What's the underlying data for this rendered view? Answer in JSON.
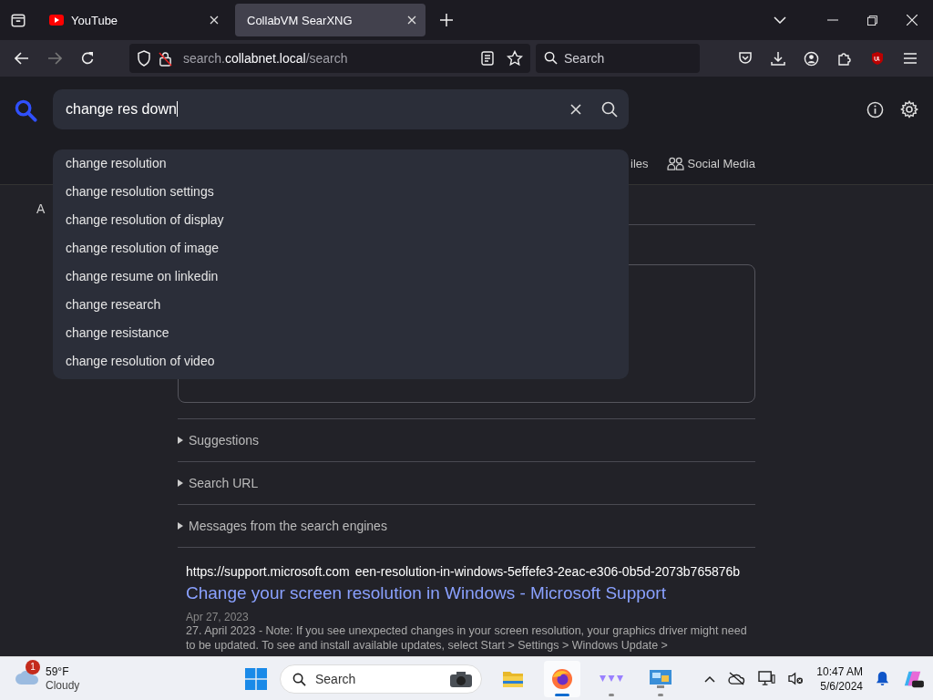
{
  "browser": {
    "tabs": [
      {
        "title": "YouTube",
        "selected": false,
        "kind": "youtube"
      },
      {
        "title": "CollabVM SearXNG",
        "selected": true,
        "kind": "plain"
      }
    ],
    "address": {
      "subdomain": "search.",
      "domain": "collabnet.local",
      "path": "/search"
    },
    "search_box": {
      "placeholder": "Search"
    }
  },
  "page": {
    "query": "change res down",
    "autocomplete": [
      "change resolution",
      "change resolution settings",
      "change resolution of display",
      "change resolution of image",
      "change resume on linkedin",
      "change research",
      "change resistance",
      "change resolution of video"
    ],
    "categories": [
      {
        "label": "iles",
        "kind": "plain"
      },
      {
        "label": "Social Media",
        "kind": "people"
      }
    ],
    "left_fragment": "A",
    "sections": [
      "Suggestions",
      "Search URL",
      "Messages from the search engines"
    ],
    "result": {
      "site": "https://support.microsoft.com",
      "path": "een-resolution-in-windows-5effefe3-2eac-e306-0b5d-2073b765876b",
      "title": "Change your screen resolution in Windows - Microsoft Support",
      "date": "Apr 27, 2023",
      "snippet": "27. April 2023 - Note: If you see unexpected changes in your screen resolution, your graphics driver might need to be updated. To see and install available updates, select Start > Settings > Windows Update >"
    }
  },
  "taskbar": {
    "weather": {
      "badge": "1",
      "temp": "59°F",
      "condition": "Cloudy"
    },
    "search_placeholder": "Search",
    "apps": [
      {
        "kind": "folder",
        "active": false,
        "running": false
      },
      {
        "kind": "firefox",
        "active": true,
        "running": true
      },
      {
        "kind": "dots",
        "active": false,
        "running": true
      },
      {
        "kind": "display",
        "active": false,
        "running": true
      }
    ],
    "time": "10:47 AM",
    "date": "5/6/2024"
  }
}
